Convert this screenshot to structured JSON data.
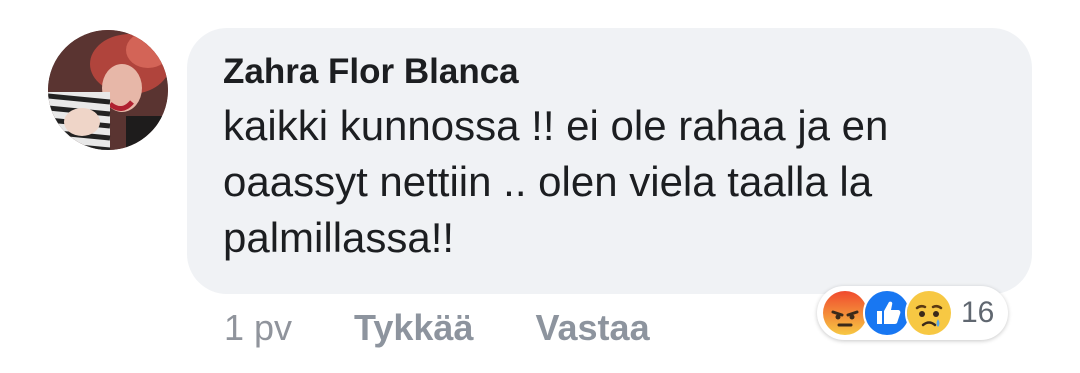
{
  "comment": {
    "author": "Zahra Flor Blanca",
    "text": "kaikki kunnossa !! ei ole rahaa ja en oaassyt nettiin .. olen viela taalla la palmillassa!!",
    "timestamp": "1 pv",
    "like_label": "Tykkää",
    "reply_label": "Vastaa",
    "reactions": {
      "icons": [
        "angry-reaction-icon",
        "like-reaction-icon",
        "sad-reaction-icon"
      ],
      "count": "16"
    }
  },
  "colors": {
    "bubble": "#f0f2f5",
    "text": "#1c1e21",
    "muted": "#8d949e",
    "like_blue": "#1877f2",
    "angry_top": "#f04a2e",
    "sad_yellow": "#f7c843"
  }
}
